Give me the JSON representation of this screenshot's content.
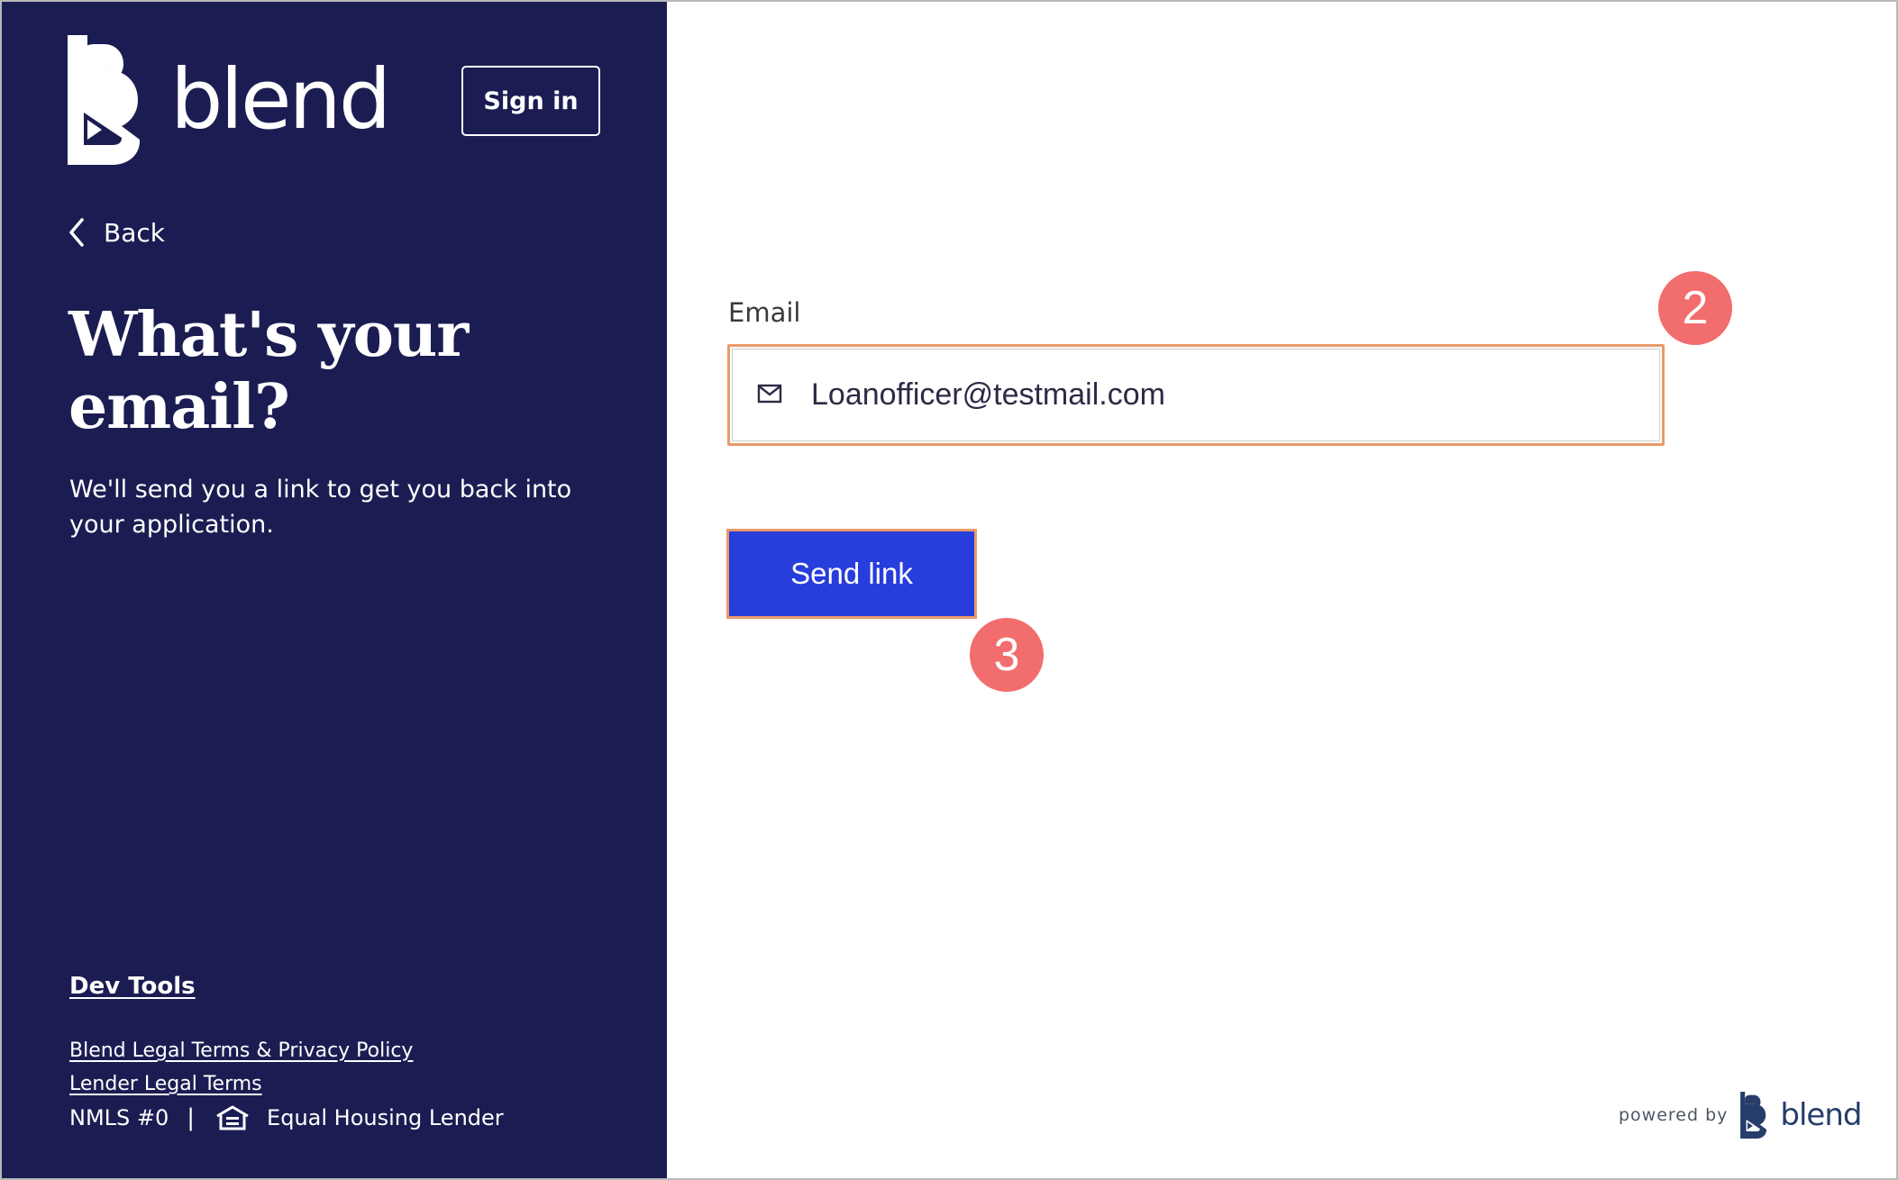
{
  "brand": {
    "name": "blend",
    "logo_icon": "blend-b-logo-icon",
    "panel_color": "#1b1d52",
    "accent_color": "#273ddc",
    "highlight_color": "#e99a6b",
    "badge_color": "#f26d6d"
  },
  "header": {
    "sign_in_label": "Sign in"
  },
  "nav": {
    "back_label": "Back",
    "back_icon": "chevron-left-icon"
  },
  "intro": {
    "title": "What's your email?",
    "subtitle": "We'll send you a link to get you back into your application."
  },
  "footer": {
    "dev_tools_label": "Dev Tools",
    "blend_legal_label": "Blend Legal Terms & Privacy Policy",
    "lender_legal_label": "Lender Legal Terms",
    "nmls_label": "NMLS #0",
    "separator": "|",
    "housing_icon": "equal-housing-icon",
    "equal_housing_label": "Equal Housing Lender"
  },
  "form": {
    "email_label": "Email",
    "email_icon": "mail-icon",
    "email_value": "Loanofficer@testmail.com",
    "send_button_label": "Send link"
  },
  "annotations": {
    "step_2": "2",
    "step_3": "3"
  },
  "powered_by": {
    "prefix": "powered by",
    "brand": "blend"
  }
}
